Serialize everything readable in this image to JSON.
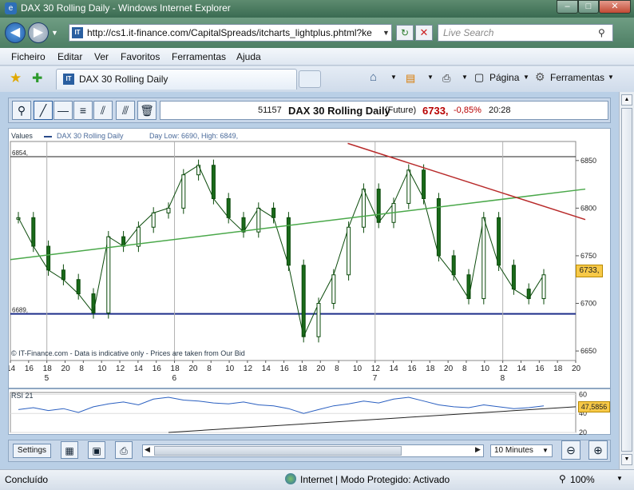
{
  "window": {
    "title": "DAX 30 Rolling Daily - Windows Internet Explorer"
  },
  "address": {
    "url": "http://cs1.it-finance.com/CapitalSpreads/itcharts_lightplus.phtml?ke",
    "search_placeholder": "Live Search"
  },
  "menu": [
    "Ficheiro",
    "Editar",
    "Ver",
    "Favoritos",
    "Ferramentas",
    "Ajuda"
  ],
  "tab": {
    "label": "DAX 30 Rolling Daily"
  },
  "tools": {
    "page_label": "Página",
    "tools_label": "Ferramentas"
  },
  "instrument": {
    "id": "51157",
    "name": "DAX 30  Rolling Daily",
    "type": "(Future)",
    "price": "6733,",
    "change": "-0,85%",
    "time": "20:28"
  },
  "chart_data": [
    {
      "type": "line",
      "subtype": "candlestick",
      "title": "",
      "legend": {
        "values_label": "Values",
        "series_name": "DAX 30  Rolling Daily",
        "day_range": "Day Low: 6690, High: 6849,"
      },
      "ylim": [
        6640,
        6870
      ],
      "yticks": [
        "6850",
        "6800",
        "6750",
        "6700",
        "6650"
      ],
      "price_label": "6733,",
      "horizontal_lines": [
        {
          "label": "6854,",
          "value": 6854
        },
        {
          "label": "6689,",
          "value": 6689
        }
      ],
      "xticks": [
        "14",
        "16",
        "18",
        "20",
        "8",
        "10",
        "12",
        "14",
        "16",
        "18",
        "20",
        "8",
        "10",
        "12",
        "14",
        "16",
        "18",
        "20",
        "8",
        "10",
        "12",
        "14",
        "16",
        "18",
        "20",
        "8",
        "10",
        "12",
        "14",
        "16",
        "18",
        "20"
      ],
      "day_labels": [
        {
          "label": "5",
          "at_tick": 2
        },
        {
          "label": "6",
          "at_tick": 9
        },
        {
          "label": "7",
          "at_tick": 20
        },
        {
          "label": "8",
          "at_tick": 27
        }
      ],
      "x": [
        0,
        2,
        4,
        6,
        8,
        10,
        12,
        14,
        16,
        18,
        20,
        22,
        24,
        26,
        28,
        30,
        32,
        34,
        36,
        38,
        40,
        42,
        44,
        46,
        48,
        50,
        52,
        54,
        56,
        58,
        60,
        62
      ],
      "series": [
        {
          "name": "DAX 30  Rolling Daily",
          "values": [
            6790,
            6760,
            6735,
            6725,
            6710,
            6690,
            6770,
            6760,
            6780,
            6795,
            6800,
            6835,
            6845,
            6810,
            6790,
            6775,
            6800,
            6790,
            6740,
            6665,
            6700,
            6730,
            6780,
            6820,
            6785,
            6805,
            6840,
            6810,
            6750,
            6730,
            6705,
            6790,
            6740,
            6715,
            6705,
            6730
          ]
        }
      ],
      "trendlines": [
        {
          "color": "#4aa84a",
          "from": [
            0,
            6746
          ],
          "to": [
            62,
            6820
          ]
        },
        {
          "color": "#b82a2a",
          "from": [
            37,
            6868
          ],
          "to": [
            62,
            6788
          ]
        }
      ],
      "footer": "© IT-Finance.com - Data is indicative only - Prices are taken from Our Bid"
    },
    {
      "type": "line",
      "title": "RSI 21",
      "ylim": [
        20,
        62
      ],
      "yticks": [
        "60",
        "40",
        "20"
      ],
      "value_label": "47,5856",
      "series": [
        {
          "name": "RSI 21",
          "values": [
            44,
            46,
            43,
            45,
            41,
            47,
            50,
            52,
            49,
            55,
            57,
            54,
            53,
            51,
            50,
            52,
            49,
            48,
            45,
            40,
            44,
            48,
            50,
            53,
            51,
            55,
            57,
            53,
            49,
            47,
            46,
            49,
            47,
            45,
            46,
            48
          ]
        }
      ]
    }
  ],
  "bottom": {
    "settings_label": "Settings",
    "interval": "10 Minutes"
  },
  "statusbar": {
    "left": "Concluído",
    "zone": "Internet | Modo Protegido: Activado",
    "zoom": "100%"
  }
}
